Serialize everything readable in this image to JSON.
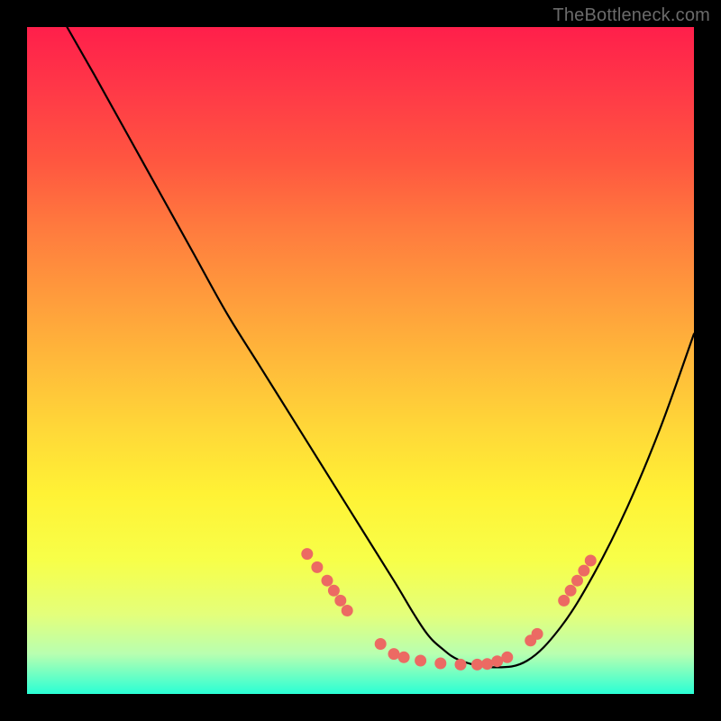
{
  "watermark": "TheBottleneck.com",
  "chart_data": {
    "type": "line",
    "title": "",
    "xlabel": "",
    "ylabel": "",
    "xlim": [
      0,
      100
    ],
    "ylim": [
      0,
      100
    ],
    "grid": false,
    "legend": false,
    "curve": {
      "name": "bottleneck-curve",
      "color": "#000000",
      "x": [
        6,
        10,
        15,
        20,
        25,
        30,
        35,
        40,
        45,
        50,
        55,
        58,
        60,
        62,
        65,
        70,
        75,
        80,
        85,
        90,
        95,
        100
      ],
      "y": [
        100,
        93,
        84,
        75,
        66,
        57,
        49,
        41,
        33,
        25,
        17,
        12,
        9,
        7,
        5,
        4,
        5,
        10,
        18,
        28,
        40,
        54
      ]
    },
    "markers": {
      "name": "highlight-points",
      "color": "#ec6a63",
      "points": [
        {
          "x": 42,
          "y": 21
        },
        {
          "x": 43.5,
          "y": 19
        },
        {
          "x": 45,
          "y": 17
        },
        {
          "x": 46,
          "y": 15.5
        },
        {
          "x": 47,
          "y": 14
        },
        {
          "x": 48,
          "y": 12.5
        },
        {
          "x": 53,
          "y": 7.5
        },
        {
          "x": 55,
          "y": 6
        },
        {
          "x": 56.5,
          "y": 5.5
        },
        {
          "x": 59,
          "y": 5
        },
        {
          "x": 62,
          "y": 4.6
        },
        {
          "x": 65,
          "y": 4.4
        },
        {
          "x": 67.5,
          "y": 4.4
        },
        {
          "x": 69,
          "y": 4.5
        },
        {
          "x": 70.5,
          "y": 4.9
        },
        {
          "x": 72,
          "y": 5.5
        },
        {
          "x": 75.5,
          "y": 8
        },
        {
          "x": 76.5,
          "y": 9
        },
        {
          "x": 80.5,
          "y": 14
        },
        {
          "x": 81.5,
          "y": 15.5
        },
        {
          "x": 82.5,
          "y": 17
        },
        {
          "x": 83.5,
          "y": 18.5
        },
        {
          "x": 84.5,
          "y": 20
        }
      ]
    }
  }
}
